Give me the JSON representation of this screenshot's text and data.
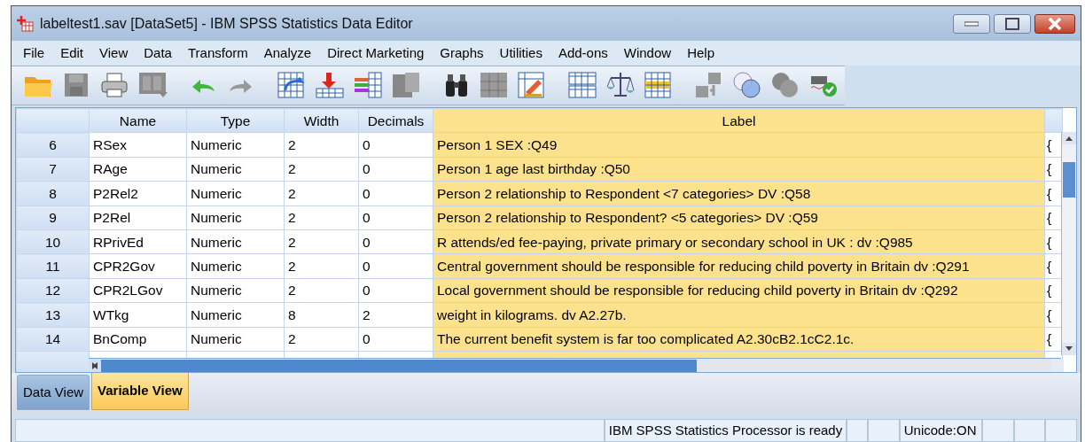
{
  "window": {
    "title": "labeltest1.sav [DataSet5] - IBM SPSS Statistics Data Editor"
  },
  "menu": [
    "File",
    "Edit",
    "View",
    "Data",
    "Transform",
    "Analyze",
    "Direct Marketing",
    "Graphs",
    "Utilities",
    "Add-ons",
    "Window",
    "Help"
  ],
  "table": {
    "columns": [
      "Name",
      "Type",
      "Width",
      "Decimals",
      "Label"
    ],
    "rows": [
      {
        "number": "6",
        "cells": [
          "RSex",
          "Numeric",
          "2",
          "0",
          "Person 1 SEX :Q49",
          "{"
        ]
      },
      {
        "number": "7",
        "cells": [
          "RAge",
          "Numeric",
          "2",
          "0",
          "Person 1 age last birthday :Q50",
          "{"
        ]
      },
      {
        "number": "8",
        "cells": [
          "P2Rel2",
          "Numeric",
          "2",
          "0",
          "Person 2 relationship to Respondent <7 categories> DV :Q58",
          "{"
        ]
      },
      {
        "number": "9",
        "cells": [
          "P2Rel",
          "Numeric",
          "2",
          "0",
          "Person 2 relationship to Respondent? <5 categories> DV :Q59",
          "{"
        ]
      },
      {
        "number": "10",
        "cells": [
          "RPrivEd",
          "Numeric",
          "2",
          "0",
          "R attends/ed fee-paying, private primary or secondary school in UK : dv :Q985",
          "{"
        ]
      },
      {
        "number": "11",
        "cells": [
          "CPR2Gov",
          "Numeric",
          "2",
          "0",
          "Central government should be responsible for reducing child poverty in Britain dv :Q291",
          "{"
        ]
      },
      {
        "number": "12",
        "cells": [
          "CPR2LGov",
          "Numeric",
          "2",
          "0",
          "Local government  should be responsible for reducing child poverty in Britain dv :Q292",
          "{"
        ]
      },
      {
        "number": "13",
        "cells": [
          "WTkg",
          "Numeric",
          "8",
          "2",
          "weight in kilograms. dv A2.27b.",
          "{"
        ]
      },
      {
        "number": "14",
        "cells": [
          "BnComp",
          "Numeric",
          "2",
          "0",
          "The current benefit system is far too complicated A2.30cB2.1cC2.1c.",
          "{"
        ]
      }
    ]
  },
  "tabs": [
    {
      "label": "Data View",
      "selected": false
    },
    {
      "label": "Variable View",
      "selected": true
    }
  ],
  "status_bar": {
    "message": "IBM SPSS Statistics Processor is ready",
    "encoding": "Unicode:ON"
  }
}
